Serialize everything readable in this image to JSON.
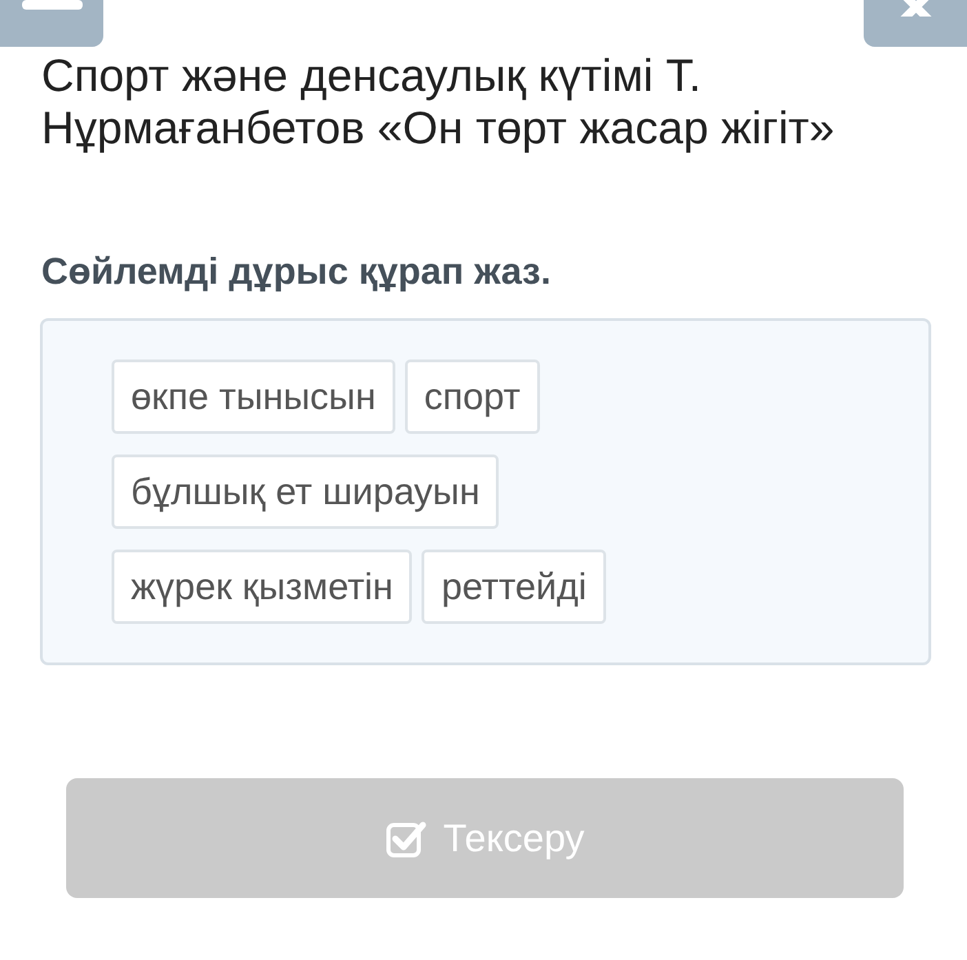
{
  "title": "Спорт және денсаулық күтімі Т. Нұрмағанбетов «Он төрт жасар жігіт»",
  "instruction": "Сөйлемді дұрыс құрап жаз.",
  "words": [
    {
      "text": "өкпе тынысын"
    },
    {
      "text": "спорт"
    },
    {
      "text": "бұлшық ет ширауын"
    },
    {
      "text": "жүрек қызметін"
    },
    {
      "text": "реттейді"
    }
  ],
  "check_button": {
    "label": "Тексеру",
    "disabled": true
  }
}
